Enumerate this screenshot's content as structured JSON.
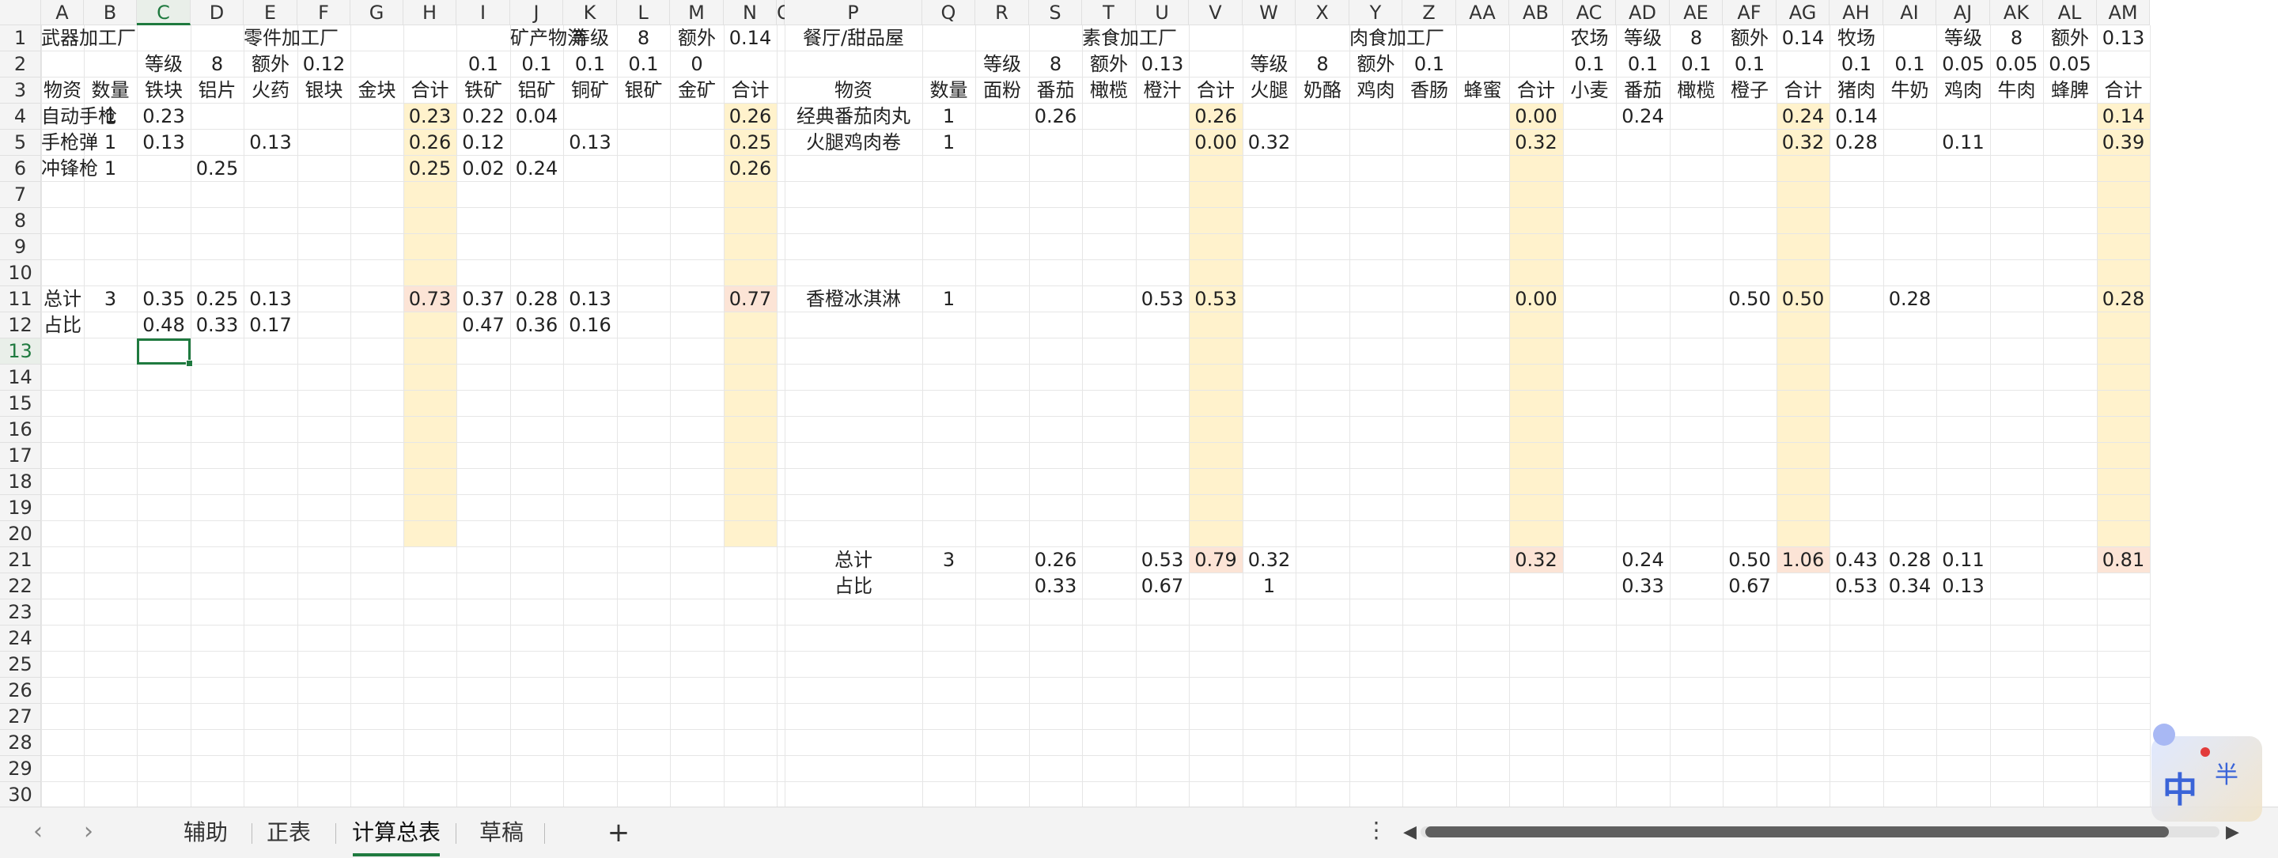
{
  "columns": [
    "A",
    "B",
    "C",
    "D",
    "E",
    "F",
    "G",
    "H",
    "I",
    "J",
    "K",
    "L",
    "M",
    "N",
    "O",
    "P",
    "Q",
    "R",
    "S",
    "T",
    "U",
    "V",
    "W",
    "X",
    "Y",
    "Z",
    "AA",
    "AB",
    "AC",
    "AD",
    "AE",
    "AF",
    "AG",
    "AH",
    "AI",
    "AJ",
    "AK",
    "AL",
    "AM"
  ],
  "active_cell": "C13",
  "colors": {
    "sum_column": "#fff2cc",
    "total_cell": "#fce4d6",
    "accent": "#1f7a3f"
  },
  "cells": {
    "A1": "武器加工厂",
    "E1": "零件加工厂",
    "J1": "矿产物流",
    "K1": "等级",
    "L1": "8",
    "M1": "额外",
    "N1": "0.14",
    "P1": "餐厅/甜品屋",
    "T1": "素食加工厂",
    "Y1": "肉食加工厂",
    "AC1": "农场",
    "AD1": "等级",
    "AE1": "8",
    "AF1": "额外",
    "AG1": "0.14",
    "AH1": "牧场",
    "AJ1": "等级",
    "AK1": "8",
    "AL1": "额外",
    "AM1": "0.13",
    "C2": "等级",
    "D2": "8",
    "E2": "额外",
    "F2": "0.12",
    "I2": "0.1",
    "J2": "0.1",
    "K2": "0.1",
    "L2": "0.1",
    "M2": "0",
    "R2": "等级",
    "S2": "8",
    "T2": "额外",
    "U2": "0.13",
    "W2": "等级",
    "X2": "8",
    "Y2": "额外",
    "Z2": "0.1",
    "AC2": "0.1",
    "AD2": "0.1",
    "AE2": "0.1",
    "AF2": "0.1",
    "AH2": "0.1",
    "AI2": "0.1",
    "AJ2": "0.05",
    "AK2": "0.05",
    "AL2": "0.05",
    "A3": "物资",
    "B3": "数量",
    "C3": "铁块",
    "D3": "铝片",
    "E3": "火药",
    "F3": "银块",
    "G3": "金块",
    "H3": "合计",
    "I3": "铁矿",
    "J3": "铝矿",
    "K3": "铜矿",
    "L3": "银矿",
    "M3": "金矿",
    "N3": "合计",
    "P3": "物资",
    "Q3": "数量",
    "R3": "面粉",
    "S3": "番茄",
    "T3": "橄榄",
    "U3": "橙汁",
    "V3": "合计",
    "W3": "火腿",
    "X3": "奶酪",
    "Y3": "鸡肉",
    "Z3": "香肠",
    "AA3": "蜂蜜",
    "AB3": "合计",
    "AC3": "小麦",
    "AD3": "番茄",
    "AE3": "橄榄",
    "AF3": "橙子",
    "AG3": "合计",
    "AH3": "猪肉",
    "AI3": "牛奶",
    "AJ3": "鸡肉",
    "AK3": "牛肉",
    "AL3": "蜂脾",
    "AM3": "合计",
    "A4": "自动手枪",
    "B4": "1",
    "C4": "0.23",
    "H4": "0.23",
    "I4": "0.22",
    "J4": "0.04",
    "N4": "0.26",
    "P4": "经典番茄肉丸",
    "Q4": "1",
    "S4": "0.26",
    "V4": "0.26",
    "AB4": "0.00",
    "AD4": "0.24",
    "AG4": "0.24",
    "AH4": "0.14",
    "AM4": "0.14",
    "A5": "手枪弹",
    "B5": "1",
    "C5": "0.13",
    "E5": "0.13",
    "H5": "0.26",
    "I5": "0.12",
    "K5": "0.13",
    "N5": "0.25",
    "P5": "火腿鸡肉卷",
    "Q5": "1",
    "V5": "0.00",
    "W5": "0.32",
    "AB5": "0.32",
    "AG5": "0.32",
    "AH5": "0.28",
    "AJ5": "0.11",
    "AM5": "0.39",
    "A6": "冲锋枪",
    "B6": "1",
    "D6": "0.25",
    "H6": "0.25",
    "I6": "0.02",
    "J6": "0.24",
    "N6": "0.26",
    "A11": "总计",
    "B11": "3",
    "C11": "0.35",
    "D11": "0.25",
    "E11": "0.13",
    "H11": "0.73",
    "I11": "0.37",
    "J11": "0.28",
    "K11": "0.13",
    "N11": "0.77",
    "P11": "香橙冰淇淋",
    "Q11": "1",
    "U11": "0.53",
    "V11": "0.53",
    "AB11": "0.00",
    "AF11": "0.50",
    "AG11": "0.50",
    "AI11": "0.28",
    "AM11": "0.28",
    "A12": "占比",
    "C12": "0.48",
    "D12": "0.33",
    "E12": "0.17",
    "I12": "0.47",
    "J12": "0.36",
    "K12": "0.16",
    "P21": "总计",
    "Q21": "3",
    "S21": "0.26",
    "U21": "0.53",
    "V21": "0.79",
    "W21": "0.32",
    "AB21": "0.32",
    "AD21": "0.24",
    "AF21": "0.50",
    "AG21": "1.06",
    "AH21": "0.43",
    "AI21": "0.28",
    "AJ21": "0.11",
    "AM21": "0.81",
    "P22": "占比",
    "S22": "0.33",
    "U22": "0.67",
    "W22": "1",
    "AD22": "0.33",
    "AF22": "0.67",
    "AH22": "0.53",
    "AI22": "0.34",
    "AJ22": "0.13"
  },
  "sheet_tabs": [
    "辅助",
    "正表",
    "计算总表",
    "草稿"
  ],
  "active_tab": "计算总表",
  "tabbar": {
    "prev_icon": "‹",
    "next_icon": "›",
    "add_icon": "+",
    "more_icon": "⋮"
  },
  "ime": {
    "mode": "中",
    "width_mode": "半"
  }
}
